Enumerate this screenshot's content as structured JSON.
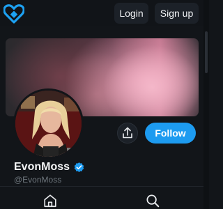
{
  "header": {
    "logo_icon": "heart-logo-icon",
    "login_label": "Login",
    "signup_label": "Sign up"
  },
  "profile": {
    "display_name": "EvonMoss",
    "handle": "@EvonMoss",
    "verified_icon": "verified-badge-icon",
    "share_icon": "share-icon",
    "follow_label": "Follow"
  },
  "bottom_nav": {
    "items": [
      {
        "icon": "home-icon"
      },
      {
        "icon": "search-icon"
      }
    ]
  },
  "colors": {
    "accent": "#1d9bf0",
    "background": "#121519",
    "brand": "#1da1f2"
  }
}
